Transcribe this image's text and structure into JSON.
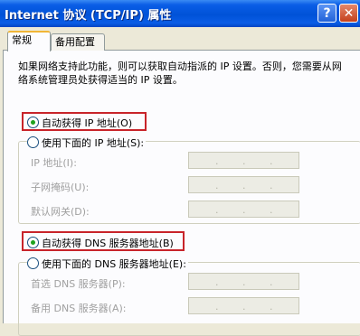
{
  "window": {
    "title": "Internet 协议 (TCP/IP) 属性",
    "help_label": "?",
    "close_label": "✕"
  },
  "tabs": [
    {
      "label": "常规"
    },
    {
      "label": "备用配置"
    }
  ],
  "description": "如果网络支持此功能，则可以获取自动指派的 IP 设置。否则，您需要从网络系统管理员处获得适当的 IP 设置。",
  "ip": {
    "auto_label": "自动获得 IP 地址(O)",
    "manual_label": "使用下面的 IP 地址(S):",
    "fields": [
      {
        "label": "IP 地址(I):"
      },
      {
        "label": "子网掩码(U):"
      },
      {
        "label": "默认网关(D):"
      }
    ]
  },
  "dns": {
    "auto_label": "自动获得 DNS 服务器地址(B)",
    "manual_label": "使用下面的 DNS 服务器地址(E):",
    "fields": [
      {
        "label": "首选 DNS 服务器(P):"
      },
      {
        "label": "备用 DNS 服务器(A):"
      }
    ]
  },
  "ip_separator": "."
}
